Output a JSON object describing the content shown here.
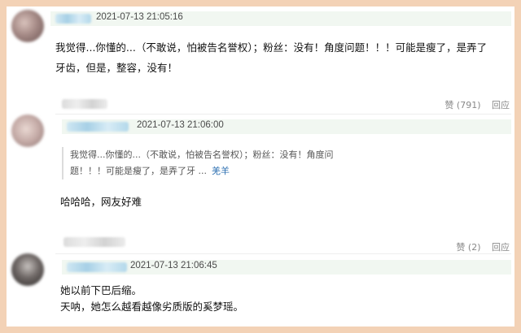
{
  "comments": [
    {
      "timestamp": "2021-07-13 21:05:16",
      "lines": [
        "我觉得...你懂的...（不敢说，怕被告名誉权）；粉丝：没有！角度问题！！！可能是瘦了，是弄了",
        "牙齿，但是，整容，没有！"
      ],
      "like_label": "赞 (791)",
      "reply_label": "回应"
    },
    {
      "timestamp": "2021-07-13 21:06:00",
      "quote_lines": [
        "我觉得...你懂的...（不敢说，怕被告名誉权）；粉丝：没有！角度问",
        "题！！！可能是瘦了，是弄了牙 ..."
      ],
      "quote_link": "羌羊",
      "lines": [
        "哈哈哈，网友好难"
      ],
      "like_label": "赞 (2)",
      "reply_label": "回应"
    },
    {
      "timestamp": "2021-07-13 21:06:45",
      "lines": [
        "她以前下巴后缩。",
        "天呐，她怎么越看越像劣质版的奚梦瑶。"
      ]
    }
  ]
}
